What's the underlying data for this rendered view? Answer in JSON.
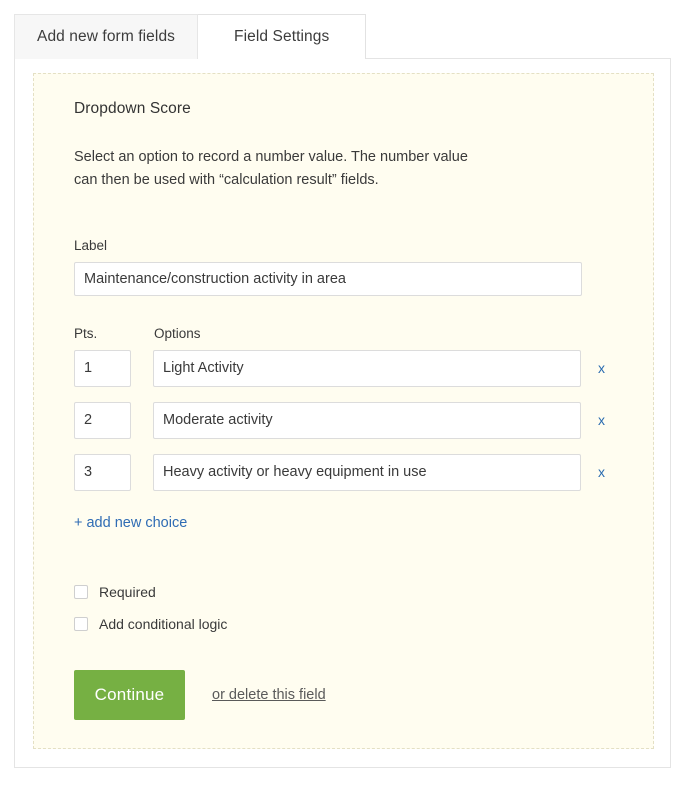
{
  "tabs": [
    {
      "label": "Add new form fields",
      "active": false
    },
    {
      "label": "Field Settings",
      "active": true
    }
  ],
  "panel": {
    "title": "Dropdown Score",
    "description": "Select an option to record a number value.  The number value\ncan then be used with “calculation result” fields.",
    "label_caption": "Label",
    "label_value": "Maintenance/construction activity in area",
    "options_header": {
      "points": "Pts.",
      "options": "Options"
    },
    "options": [
      {
        "points": "1",
        "text": "Light Activity",
        "remove": "x"
      },
      {
        "points": "2",
        "text": "Moderate activity",
        "remove": "x"
      },
      {
        "points": "3",
        "text": "Heavy activity or heavy equipment in use",
        "remove": "x"
      }
    ],
    "add_choice": "+ add new choice",
    "checkboxes": [
      {
        "label": "Required",
        "checked": false
      },
      {
        "label": "Add conditional logic",
        "checked": false
      }
    ],
    "continue_label": "Continue",
    "delete_label": "or delete this field"
  },
  "colors": {
    "panel_bg": "#fffdf0",
    "panel_border": "#e4e0c4",
    "accent_green": "#76b043",
    "link_blue": "#2f6cb4",
    "remove_blue": "#2b6cb0",
    "input_border": "#dcdcdc",
    "card_border": "#e4e4e4",
    "tab_inactive_bg": "#f7f7f7"
  }
}
